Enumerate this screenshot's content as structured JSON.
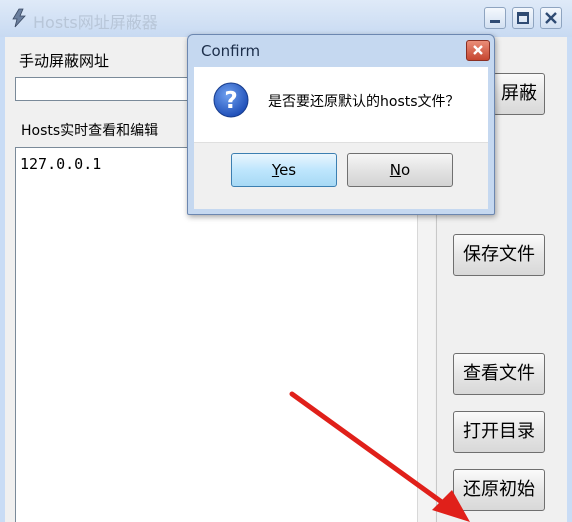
{
  "window": {
    "title": "Hosts网址屏蔽器",
    "icon": "app-icon"
  },
  "main": {
    "manual_block_label": "手动屏蔽网址",
    "url_input_value": "",
    "hosts_label": "Hosts实时查看和编辑",
    "hosts_content": "127.0.0.1"
  },
  "side_buttons": {
    "block": "屏蔽",
    "save": "保存文件",
    "view": "查看文件",
    "open_dir": "打开目录",
    "restore": "还原初始"
  },
  "dialog": {
    "title": "Confirm",
    "icon": "question-icon",
    "message": "是否要还原默认的hosts文件？",
    "yes_mnemonic": "Y",
    "yes_rest": "es",
    "no_mnemonic": "N",
    "no_rest": "o"
  },
  "colors": {
    "annotation_arrow": "#e0201a",
    "dialog_frame": "#c5d8f0",
    "close_button": "#c64630"
  }
}
